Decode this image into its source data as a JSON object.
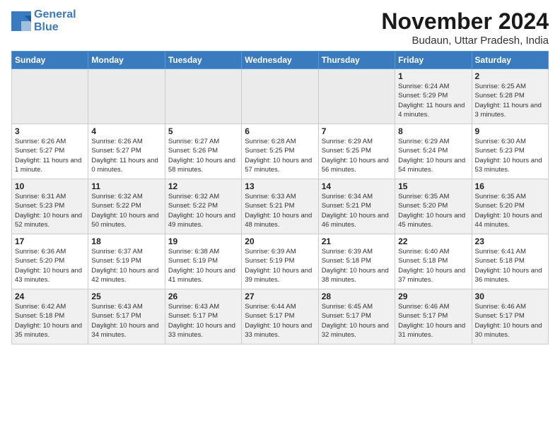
{
  "header": {
    "logo_line1": "General",
    "logo_line2": "Blue",
    "month_title": "November 2024",
    "location": "Budaun, Uttar Pradesh, India"
  },
  "weekdays": [
    "Sunday",
    "Monday",
    "Tuesday",
    "Wednesday",
    "Thursday",
    "Friday",
    "Saturday"
  ],
  "weeks": [
    [
      {
        "day": "",
        "info": ""
      },
      {
        "day": "",
        "info": ""
      },
      {
        "day": "",
        "info": ""
      },
      {
        "day": "",
        "info": ""
      },
      {
        "day": "",
        "info": ""
      },
      {
        "day": "1",
        "info": "Sunrise: 6:24 AM\nSunset: 5:29 PM\nDaylight: 11 hours and 4 minutes."
      },
      {
        "day": "2",
        "info": "Sunrise: 6:25 AM\nSunset: 5:28 PM\nDaylight: 11 hours and 3 minutes."
      }
    ],
    [
      {
        "day": "3",
        "info": "Sunrise: 6:26 AM\nSunset: 5:27 PM\nDaylight: 11 hours and 1 minute."
      },
      {
        "day": "4",
        "info": "Sunrise: 6:26 AM\nSunset: 5:27 PM\nDaylight: 11 hours and 0 minutes."
      },
      {
        "day": "5",
        "info": "Sunrise: 6:27 AM\nSunset: 5:26 PM\nDaylight: 10 hours and 58 minutes."
      },
      {
        "day": "6",
        "info": "Sunrise: 6:28 AM\nSunset: 5:25 PM\nDaylight: 10 hours and 57 minutes."
      },
      {
        "day": "7",
        "info": "Sunrise: 6:29 AM\nSunset: 5:25 PM\nDaylight: 10 hours and 56 minutes."
      },
      {
        "day": "8",
        "info": "Sunrise: 6:29 AM\nSunset: 5:24 PM\nDaylight: 10 hours and 54 minutes."
      },
      {
        "day": "9",
        "info": "Sunrise: 6:30 AM\nSunset: 5:23 PM\nDaylight: 10 hours and 53 minutes."
      }
    ],
    [
      {
        "day": "10",
        "info": "Sunrise: 6:31 AM\nSunset: 5:23 PM\nDaylight: 10 hours and 52 minutes."
      },
      {
        "day": "11",
        "info": "Sunrise: 6:32 AM\nSunset: 5:22 PM\nDaylight: 10 hours and 50 minutes."
      },
      {
        "day": "12",
        "info": "Sunrise: 6:32 AM\nSunset: 5:22 PM\nDaylight: 10 hours and 49 minutes."
      },
      {
        "day": "13",
        "info": "Sunrise: 6:33 AM\nSunset: 5:21 PM\nDaylight: 10 hours and 48 minutes."
      },
      {
        "day": "14",
        "info": "Sunrise: 6:34 AM\nSunset: 5:21 PM\nDaylight: 10 hours and 46 minutes."
      },
      {
        "day": "15",
        "info": "Sunrise: 6:35 AM\nSunset: 5:20 PM\nDaylight: 10 hours and 45 minutes."
      },
      {
        "day": "16",
        "info": "Sunrise: 6:35 AM\nSunset: 5:20 PM\nDaylight: 10 hours and 44 minutes."
      }
    ],
    [
      {
        "day": "17",
        "info": "Sunrise: 6:36 AM\nSunset: 5:20 PM\nDaylight: 10 hours and 43 minutes."
      },
      {
        "day": "18",
        "info": "Sunrise: 6:37 AM\nSunset: 5:19 PM\nDaylight: 10 hours and 42 minutes."
      },
      {
        "day": "19",
        "info": "Sunrise: 6:38 AM\nSunset: 5:19 PM\nDaylight: 10 hours and 41 minutes."
      },
      {
        "day": "20",
        "info": "Sunrise: 6:39 AM\nSunset: 5:19 PM\nDaylight: 10 hours and 39 minutes."
      },
      {
        "day": "21",
        "info": "Sunrise: 6:39 AM\nSunset: 5:18 PM\nDaylight: 10 hours and 38 minutes."
      },
      {
        "day": "22",
        "info": "Sunrise: 6:40 AM\nSunset: 5:18 PM\nDaylight: 10 hours and 37 minutes."
      },
      {
        "day": "23",
        "info": "Sunrise: 6:41 AM\nSunset: 5:18 PM\nDaylight: 10 hours and 36 minutes."
      }
    ],
    [
      {
        "day": "24",
        "info": "Sunrise: 6:42 AM\nSunset: 5:18 PM\nDaylight: 10 hours and 35 minutes."
      },
      {
        "day": "25",
        "info": "Sunrise: 6:43 AM\nSunset: 5:17 PM\nDaylight: 10 hours and 34 minutes."
      },
      {
        "day": "26",
        "info": "Sunrise: 6:43 AM\nSunset: 5:17 PM\nDaylight: 10 hours and 33 minutes."
      },
      {
        "day": "27",
        "info": "Sunrise: 6:44 AM\nSunset: 5:17 PM\nDaylight: 10 hours and 33 minutes."
      },
      {
        "day": "28",
        "info": "Sunrise: 6:45 AM\nSunset: 5:17 PM\nDaylight: 10 hours and 32 minutes."
      },
      {
        "day": "29",
        "info": "Sunrise: 6:46 AM\nSunset: 5:17 PM\nDaylight: 10 hours and 31 minutes."
      },
      {
        "day": "30",
        "info": "Sunrise: 6:46 AM\nSunset: 5:17 PM\nDaylight: 10 hours and 30 minutes."
      }
    ]
  ]
}
